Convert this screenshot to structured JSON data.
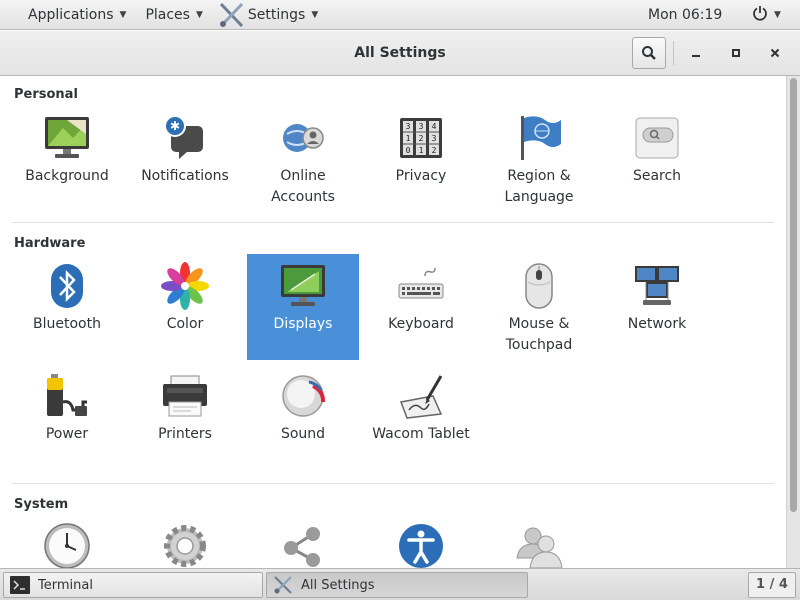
{
  "top_panel": {
    "applications_label": "Applications",
    "places_label": "Places",
    "app_label": "Settings",
    "clock": "Mon 06:19"
  },
  "window": {
    "title": "All Settings"
  },
  "sections": {
    "personal": {
      "title": "Personal",
      "items": [
        {
          "label": "Background",
          "icon": "background-icon"
        },
        {
          "label": "Notifications",
          "icon": "notifications-icon"
        },
        {
          "label": "Online\nAccounts",
          "icon": "online-accounts-icon"
        },
        {
          "label": "Privacy",
          "icon": "privacy-icon"
        },
        {
          "label": "Region &\nLanguage",
          "icon": "region-language-icon"
        },
        {
          "label": "Search",
          "icon": "search-icon"
        }
      ]
    },
    "hardware": {
      "title": "Hardware",
      "items": [
        {
          "label": "Bluetooth",
          "icon": "bluetooth-icon"
        },
        {
          "label": "Color",
          "icon": "color-icon"
        },
        {
          "label": "Displays",
          "icon": "displays-icon",
          "selected": true
        },
        {
          "label": "Keyboard",
          "icon": "keyboard-icon"
        },
        {
          "label": "Mouse &\nTouchpad",
          "icon": "mouse-icon"
        },
        {
          "label": "Network",
          "icon": "network-icon"
        },
        {
          "label": "Power",
          "icon": "power-battery-icon"
        },
        {
          "label": "Printers",
          "icon": "printer-icon"
        },
        {
          "label": "Sound",
          "icon": "sound-icon"
        },
        {
          "label": "Wacom Tablet",
          "icon": "wacom-tablet-icon"
        }
      ]
    },
    "system": {
      "title": "System",
      "items": [
        {
          "label": "",
          "icon": "clock-icon"
        },
        {
          "label": "",
          "icon": "gear-icon"
        },
        {
          "label": "",
          "icon": "sharing-icon"
        },
        {
          "label": "",
          "icon": "accessibility-icon"
        },
        {
          "label": "",
          "icon": "users-icon"
        }
      ]
    }
  },
  "taskbar": {
    "tasks": [
      {
        "label": "Terminal",
        "icon": "terminal-icon"
      },
      {
        "label": "All Settings",
        "icon": "settings-icon",
        "active": true
      }
    ],
    "workspace": "1 / 4"
  },
  "colors": {
    "selection": "#4a90d9"
  }
}
